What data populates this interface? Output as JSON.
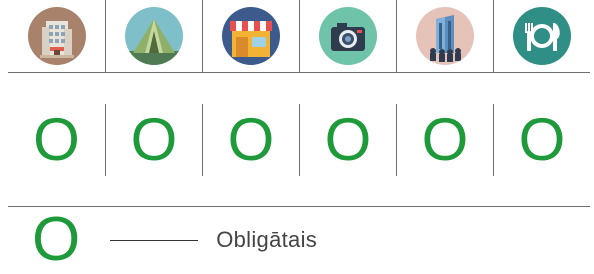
{
  "icons": [
    {
      "name": "hotel-building-icon",
      "bg": "#a8826a"
    },
    {
      "name": "tent-icon",
      "bg": "#7fbfc9"
    },
    {
      "name": "shop-storefront-icon",
      "bg": "#3c5a8c"
    },
    {
      "name": "camera-icon",
      "bg": "#6fc3a8"
    },
    {
      "name": "office-tower-people-icon",
      "bg": "#e6c3b8"
    },
    {
      "name": "dining-plate-cutlery-icon",
      "bg": "#2f8f86"
    }
  ],
  "marks": [
    "O",
    "O",
    "O",
    "O",
    "O",
    "O"
  ],
  "legend": {
    "symbol": "O",
    "label": "Obligātais"
  },
  "colors": {
    "mark": "#1f9a3a",
    "rule": "#6f6f6f"
  }
}
